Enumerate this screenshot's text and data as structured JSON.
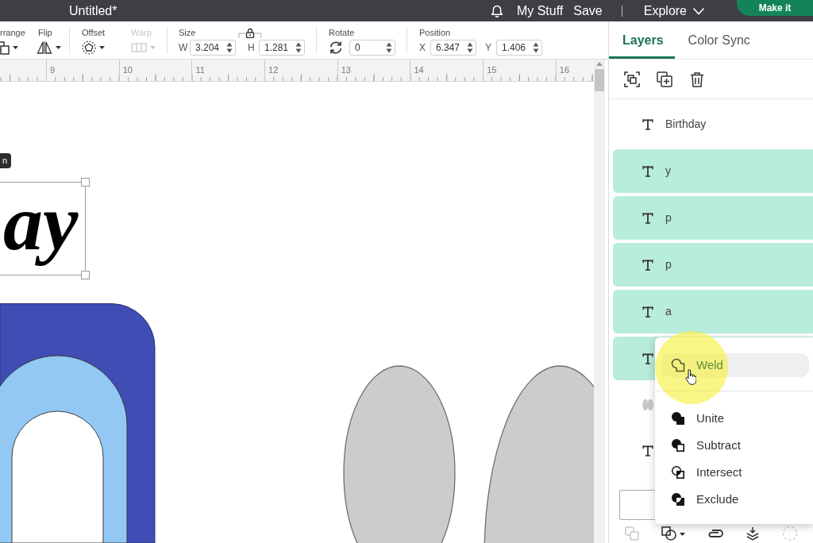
{
  "app_bar": {
    "title": "Untitled*",
    "links": [
      "My Stuff",
      "Save"
    ],
    "menu": "Explore",
    "action": "Make it"
  },
  "toolbar": {
    "tools": [
      {
        "kind": "arrange",
        "label": "rrange",
        "disabled": false
      },
      {
        "kind": "flip",
        "label": "Flip",
        "disabled": false
      },
      {
        "kind": "offset",
        "label": "Offset",
        "disabled": false
      },
      {
        "kind": "warp",
        "label": "Warp",
        "disabled": true
      }
    ],
    "size": {
      "label": "Size",
      "fields": [
        {
          "label": "W",
          "value": "3.204"
        },
        {
          "label": "H",
          "value": "1.281"
        }
      ]
    },
    "rotate": {
      "label": "Rotate",
      "value": "0"
    },
    "position": {
      "label": "Position",
      "fields": [
        {
          "label": "X",
          "value": "6.347"
        },
        {
          "label": "Y",
          "value": "1.406"
        }
      ]
    }
  },
  "ruler": {
    "labels": [
      "9",
      "10",
      "11",
      "12",
      "13",
      "14",
      "15",
      "16"
    ]
  },
  "canvas": {
    "tooltip": "n",
    "selected_text": "ay"
  },
  "panel": {
    "tabs": [
      {
        "label": "Layers",
        "selected": true
      },
      {
        "label": "Color Sync",
        "selected": false
      }
    ],
    "layers": [
      {
        "kind": "text",
        "name": "Birthday",
        "selected": false
      },
      {
        "kind": "text",
        "name": "y",
        "selected": true
      },
      {
        "kind": "text",
        "name": "p",
        "selected": true
      },
      {
        "kind": "text",
        "name": "p",
        "selected": true
      },
      {
        "kind": "text",
        "name": "a",
        "selected": true
      },
      {
        "kind": "text",
        "selected": true
      },
      {
        "kind": "shape",
        "selected": false
      },
      {
        "kind": "text",
        "selected": false
      }
    ],
    "tools": [
      {
        "kind": "stacked-squares",
        "disabled": true
      },
      {
        "kind": "shapes",
        "disabled": false
      },
      {
        "kind": "paperclip",
        "disabled": false
      },
      {
        "kind": "arrow-layers",
        "disabled": false
      },
      {
        "kind": "dashed-circle",
        "disabled": true
      }
    ]
  },
  "combine_menu": {
    "sections": [
      {
        "items": [
          {
            "kind": "weld",
            "label": "Weld",
            "hovered": true
          }
        ]
      },
      {
        "items": [
          {
            "kind": "unite",
            "label": "Unite",
            "hovered": false
          },
          {
            "kind": "subtract",
            "label": "Subtract",
            "hovered": false
          },
          {
            "kind": "intersect",
            "label": "Intersect",
            "hovered": false
          },
          {
            "kind": "exclude",
            "label": "Exclude",
            "hovered": false
          }
        ]
      }
    ]
  }
}
